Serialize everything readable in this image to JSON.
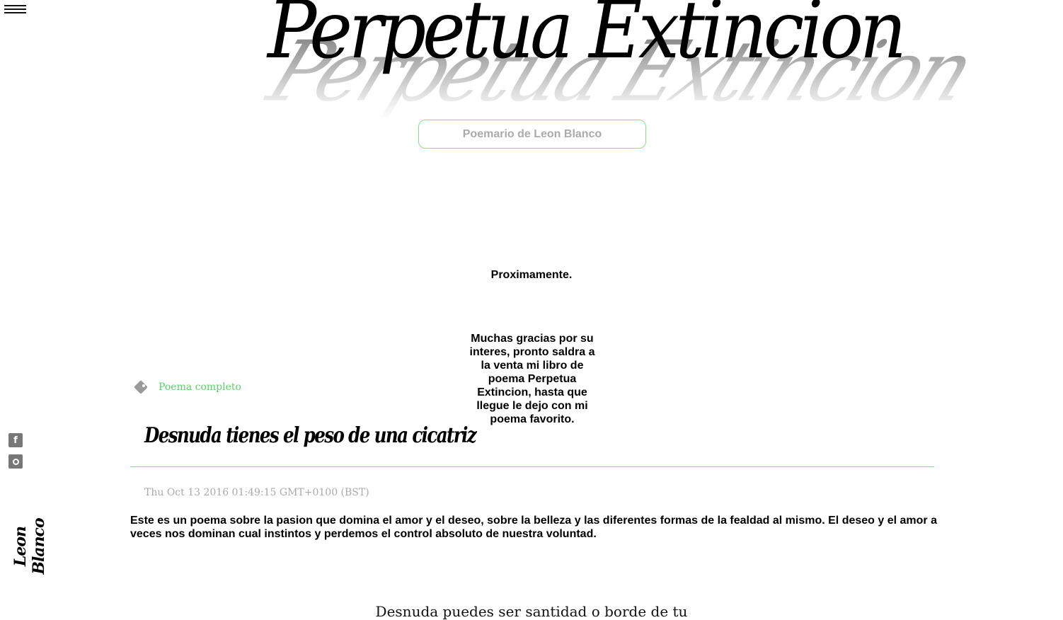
{
  "header": {
    "site_title": "Perpetua Extincion",
    "subtitle": "Poemario de Leon Blanco"
  },
  "sidebar": {
    "menu_icon": "hamburger-icon",
    "social": [
      {
        "name": "facebook-icon",
        "glyph": "f"
      },
      {
        "name": "instagram-icon",
        "glyph": ""
      }
    ],
    "author_name": "Leon Blanco"
  },
  "announcement": {
    "title": "Proximamente.",
    "body": "Muchas gracias por su interes, pronto saldra a la venta mi libro de poema Perpetua Extincion, hasta que llegue le dejo con mi poema favorito."
  },
  "post": {
    "tag": "Poema completo",
    "title": "Desnuda tienes el peso de una cicatriz",
    "date": "Thu Oct 13 2016 01:49:15 GMT+0100 (BST)",
    "excerpt": "Este es un poema sobre la pasion que domina el amor y el deseo, sobre la belleza y las diferentes formas de la fealdad al mismo. El deseo y el amor a veces nos dominan cual instintos y perdemos el control absoluto de nuestra voluntad.",
    "body_first_line": "Desnuda puedes ser santidad o borde de tu"
  },
  "colors": {
    "accent": "#86e08f",
    "tag_link": "#5ccf6a",
    "muted_text": "#aaaaaa"
  }
}
